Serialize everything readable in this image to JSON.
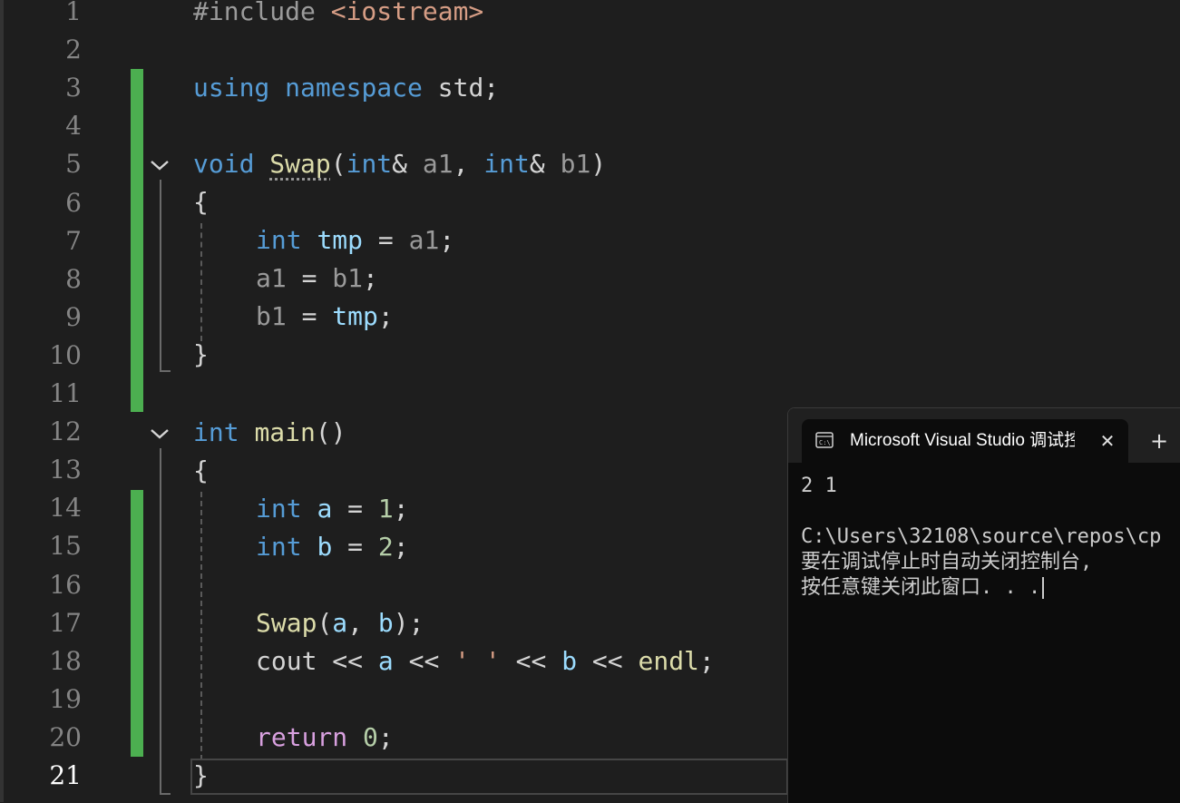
{
  "editor": {
    "line_numbers": [
      "1",
      "2",
      "3",
      "4",
      "5",
      "6",
      "7",
      "8",
      "9",
      "10",
      "11",
      "12",
      "13",
      "14",
      "15",
      "16",
      "17",
      "18",
      "19",
      "20",
      "21"
    ],
    "current_line": "21",
    "code": {
      "l1": {
        "directive": "#include",
        "header": "<iostream>"
      },
      "l3": {
        "kw_using": "using",
        "kw_namespace": "namespace",
        "rest": " std;"
      },
      "l5": {
        "kw_void": "void",
        "fn_name": "Swap",
        "paren_open": "(",
        "kw_int1": "int",
        "amp1": "&",
        "p1": "a1",
        "comma": ", ",
        "kw_int2": "int",
        "amp2": "&",
        "p2": "b1",
        "paren_close": ")"
      },
      "l6": {
        "brace": "{"
      },
      "l7": {
        "kw_int": "int",
        "var": "tmp",
        "op": " = ",
        "p": "a1",
        "semi": ";"
      },
      "l8": {
        "p1": "a1",
        "op": " = ",
        "p2": "b1",
        "semi": ";"
      },
      "l9": {
        "p": "b1",
        "op": " = ",
        "var": "tmp",
        "semi": ";"
      },
      "l10": {
        "brace": "}"
      },
      "l12": {
        "kw_int": "int",
        "fn_name": "main",
        "parens": "()"
      },
      "l13": {
        "brace": "{"
      },
      "l14": {
        "kw_int": "int",
        "var": "a",
        "op": " = ",
        "num": "1",
        "semi": ";"
      },
      "l15": {
        "kw_int": "int",
        "var": "b",
        "op": " = ",
        "num": "2",
        "semi": ";"
      },
      "l17": {
        "fn_name": "Swap",
        "open": "(",
        "a": "a",
        "comma": ", ",
        "b": "b",
        "close": ");"
      },
      "l18": {
        "cout": "cout",
        "op1": " << ",
        "a": "a",
        "op2": " << ",
        "chr": "' '",
        "op3": " << ",
        "b": "b",
        "op4": " << ",
        "endl": "endl",
        "semi": ";"
      },
      "l20": {
        "kw_return": "return",
        "num": "0",
        "semi": ";"
      },
      "l21": {
        "brace": "}"
      }
    }
  },
  "console": {
    "tab_title": "Microsoft Visual Studio 调试控",
    "tab_icon": "console-app-icon",
    "close_glyph": "✕",
    "new_tab_glyph": "+",
    "output": {
      "line1": "2 1",
      "line2": "C:\\Users\\32108\\source\\repos\\cp",
      "line3": "要在调试停止时自动关闭控制台,",
      "line4": "按任意键关闭此窗口. . ."
    }
  },
  "colors": {
    "editor_bg": "#1e1e1e",
    "keyword": "#569cd6",
    "control_keyword": "#d8a0df",
    "function": "#dcdcaa",
    "variable": "#9cdcfe",
    "parameter": "#9a9a9a",
    "number": "#b5cea8",
    "string": "#d69d85",
    "change_bar": "#4caf50",
    "console_bg": "#0c0c0c"
  }
}
